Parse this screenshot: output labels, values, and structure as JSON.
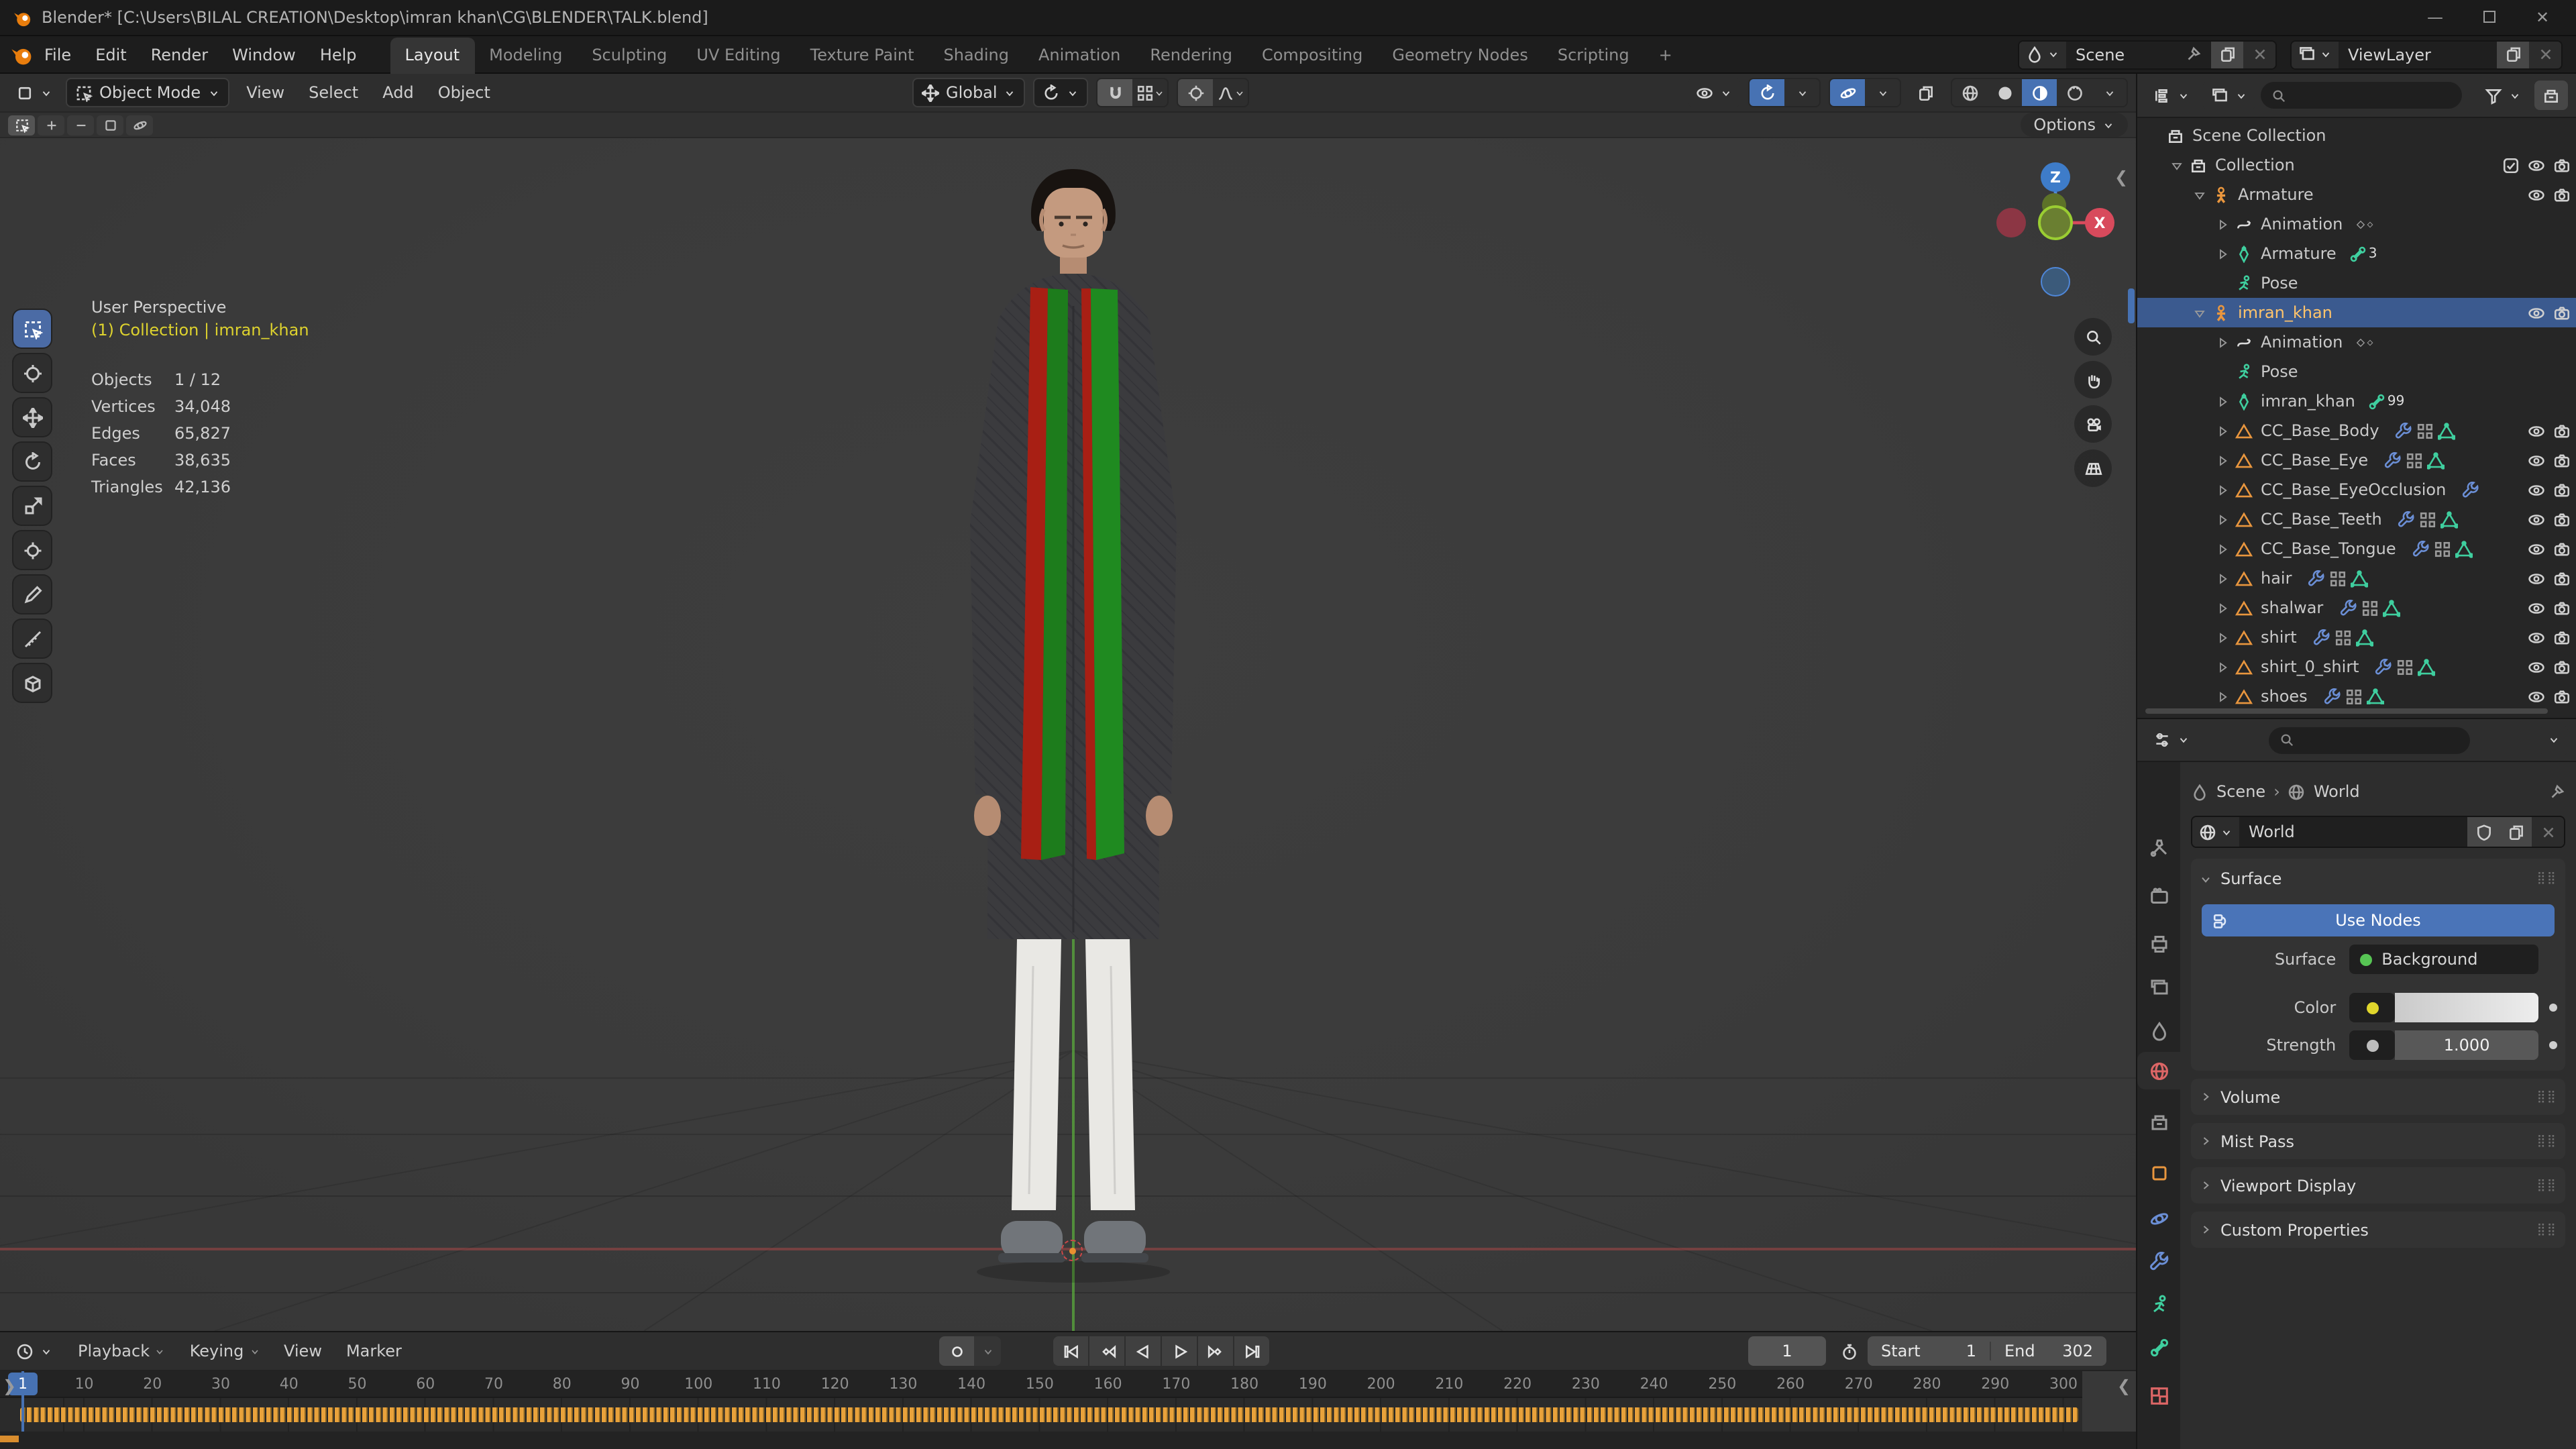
{
  "window": {
    "title": "Blender* [C:\\Users\\BILAL CREATION\\Desktop\\imran khan\\CG\\BLENDER\\TALK.blend]"
  },
  "topbar": {
    "menus": [
      "File",
      "Edit",
      "Render",
      "Window",
      "Help"
    ],
    "tabs": [
      "Layout",
      "Modeling",
      "Sculpting",
      "UV Editing",
      "Texture Paint",
      "Shading",
      "Animation",
      "Rendering",
      "Compositing",
      "Geometry Nodes",
      "Scripting",
      "+"
    ],
    "active_tab": "Layout",
    "scene_selector": {
      "value": "Scene"
    },
    "view_layer_selector": {
      "value": "ViewLayer"
    }
  },
  "viewport": {
    "header": {
      "mode": "Object Mode",
      "menus": [
        "View",
        "Select",
        "Add",
        "Object"
      ],
      "orientation": "Global",
      "options": "Options"
    },
    "overlay": {
      "view_name": "User Perspective",
      "context": "(1) Collection | imran_khan",
      "stats": [
        {
          "label": "Objects",
          "value": "1 / 12"
        },
        {
          "label": "Vertices",
          "value": "34,048"
        },
        {
          "label": "Edges",
          "value": "65,827"
        },
        {
          "label": "Faces",
          "value": "38,635"
        },
        {
          "label": "Triangles",
          "value": "42,136"
        }
      ]
    },
    "gizmo_axes": {
      "z": "Z",
      "x": "X"
    }
  },
  "toolbar": {
    "tools": [
      "select-box",
      "cursor",
      "move",
      "rotate",
      "scale",
      "transform",
      "annotate",
      "measure",
      "add-cube"
    ],
    "active_tool": "select-box"
  },
  "outliner": {
    "rows": [
      {
        "d": 0,
        "a": 0,
        "icon": "collection",
        "label": "Scene Collection",
        "right": []
      },
      {
        "d": 1,
        "a": 1,
        "icon": "collection",
        "label": "Collection",
        "right": [
          "check",
          "eye",
          "camera"
        ]
      },
      {
        "d": 2,
        "a": 1,
        "icon": "armature-object",
        "color": "orange",
        "label": "Armature",
        "right": [
          "eye",
          "camera"
        ]
      },
      {
        "d": 3,
        "a": 2,
        "icon": "animation",
        "color": "white",
        "label": "Animation",
        "badge": "keys",
        "right": []
      },
      {
        "d": 3,
        "a": 2,
        "icon": "armature-data",
        "color": "green",
        "label": "Armature",
        "badge": "bone:3",
        "right": []
      },
      {
        "d": 3,
        "a": 0,
        "icon": "pose",
        "color": "green",
        "label": "Pose",
        "right": []
      },
      {
        "d": 2,
        "a": 1,
        "icon": "armature-object",
        "color": "orange",
        "label": "imran_khan",
        "sel": true,
        "right": [
          "eye",
          "camera"
        ]
      },
      {
        "d": 3,
        "a": 2,
        "icon": "animation",
        "color": "white",
        "label": "Animation",
        "badge": "keys",
        "right": []
      },
      {
        "d": 3,
        "a": 0,
        "icon": "pose",
        "color": "green",
        "label": "Pose",
        "right": []
      },
      {
        "d": 3,
        "a": 2,
        "icon": "armature-data",
        "color": "green",
        "label": "imran_khan",
        "badge": "bone:99",
        "right": []
      },
      {
        "d": 3,
        "a": 2,
        "icon": "mesh",
        "color": "orange",
        "label": "CC_Base_Body",
        "mid": [
          "wrench",
          "grid",
          "meshdata"
        ],
        "right": [
          "eye",
          "camera"
        ]
      },
      {
        "d": 3,
        "a": 2,
        "icon": "mesh",
        "color": "orange",
        "label": "CC_Base_Eye",
        "mid": [
          "wrench",
          "grid",
          "meshdata"
        ],
        "right": [
          "eye",
          "camera"
        ]
      },
      {
        "d": 3,
        "a": 2,
        "icon": "mesh",
        "color": "orange",
        "label": "CC_Base_EyeOcclusion",
        "mid": [
          "wrench"
        ],
        "right": [
          "eye",
          "camera"
        ]
      },
      {
        "d": 3,
        "a": 2,
        "icon": "mesh",
        "color": "orange",
        "label": "CC_Base_Teeth",
        "mid": [
          "wrench",
          "grid",
          "meshdata"
        ],
        "right": [
          "eye",
          "camera"
        ]
      },
      {
        "d": 3,
        "a": 2,
        "icon": "mesh",
        "color": "orange",
        "label": "CC_Base_Tongue",
        "mid": [
          "wrench",
          "grid",
          "meshdata"
        ],
        "right": [
          "eye",
          "camera"
        ]
      },
      {
        "d": 3,
        "a": 2,
        "icon": "mesh",
        "color": "orange",
        "label": "hair",
        "mid": [
          "wrench",
          "grid",
          "meshdata"
        ],
        "right": [
          "eye",
          "camera"
        ]
      },
      {
        "d": 3,
        "a": 2,
        "icon": "mesh",
        "color": "orange",
        "label": "shalwar",
        "mid": [
          "wrench",
          "grid",
          "meshdata"
        ],
        "right": [
          "eye",
          "camera"
        ]
      },
      {
        "d": 3,
        "a": 2,
        "icon": "mesh",
        "color": "orange",
        "label": "shirt",
        "mid": [
          "wrench",
          "grid",
          "meshdata"
        ],
        "right": [
          "eye",
          "camera"
        ]
      },
      {
        "d": 3,
        "a": 2,
        "icon": "mesh",
        "color": "orange",
        "label": "shirt_0_shirt",
        "mid": [
          "wrench",
          "grid",
          "meshdata"
        ],
        "right": [
          "eye",
          "camera"
        ]
      },
      {
        "d": 3,
        "a": 2,
        "icon": "mesh",
        "color": "orange",
        "label": "shoes",
        "mid": [
          "wrench",
          "grid",
          "meshdata"
        ],
        "right": [
          "eye",
          "camera"
        ]
      }
    ]
  },
  "properties": {
    "breadcrumb": {
      "scene": "Scene",
      "datablock": "World"
    },
    "world_name": "World",
    "surface_panel": {
      "title": "Surface",
      "use_nodes": "Use Nodes",
      "surface_label": "Surface",
      "surface_value": "Background",
      "color_label": "Color",
      "strength_label": "Strength",
      "strength_value": "1.000"
    },
    "collapsed_panels": [
      "Volume",
      "Mist Pass",
      "Viewport Display",
      "Custom Properties"
    ],
    "tabs": [
      "tool",
      "render",
      "output",
      "view-layer",
      "scene",
      "world",
      "collection",
      "object",
      "physics",
      "constraints",
      "data",
      "bone",
      "texture"
    ],
    "active_tab": "world"
  },
  "timeline": {
    "menus": [
      "Playback",
      "Keying",
      "View",
      "Marker"
    ],
    "current_frame": "1",
    "start_label": "Start",
    "start_value": "1",
    "end_label": "End",
    "end_value": "302",
    "ticks": [
      10,
      20,
      30,
      40,
      50,
      60,
      70,
      80,
      90,
      100,
      110,
      120,
      130,
      140,
      150,
      160,
      170,
      180,
      190,
      200,
      210,
      220,
      230,
      240,
      250,
      260,
      270,
      280,
      290,
      300
    ],
    "keyframe_range": {
      "start": 1,
      "end": 302
    }
  },
  "colors": {
    "accent": "#4772b3",
    "selected_row": "#3b5a8f",
    "keyframe_orange": "#e9a23b",
    "object_orange": "#e9963e",
    "data_green": "#3fcf9f",
    "context_yellow": "#ddd22e",
    "world_tab_red": "#e05f5f"
  }
}
